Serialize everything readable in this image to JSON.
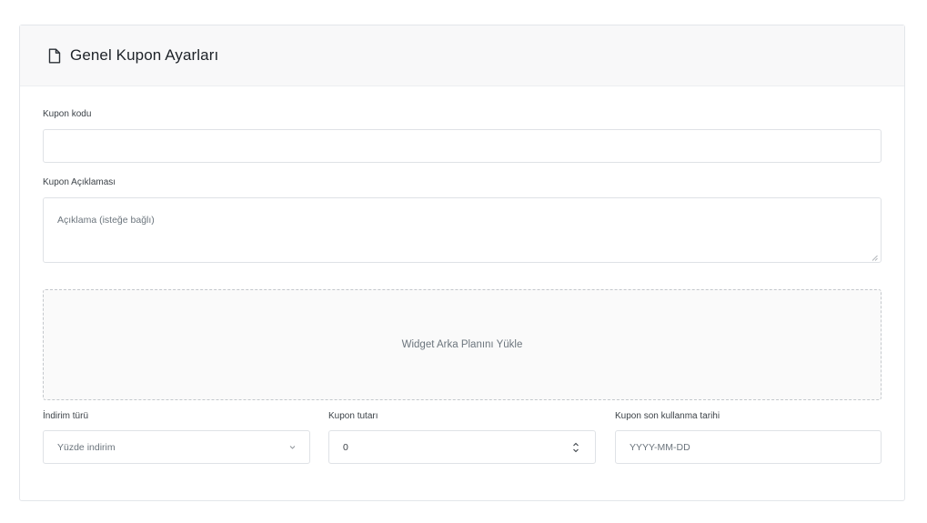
{
  "header": {
    "title": "Genel Kupon Ayarları",
    "icon": "document-icon"
  },
  "form": {
    "coupon_code": {
      "label": "Kupon kodu",
      "value": "",
      "placeholder": ""
    },
    "coupon_description": {
      "label": "Kupon Açıklaması",
      "value": "",
      "placeholder": "Açıklama (isteğe bağlı)"
    },
    "upload": {
      "label": "Widget Arka Planını Yükle"
    },
    "discount_type": {
      "label": "İndirim türü",
      "selected": "Yüzde indirim"
    },
    "coupon_amount": {
      "label": "Kupon tutarı",
      "value": "0"
    },
    "expiry_date": {
      "label": "Kupon son kullanma tarihi",
      "placeholder": "YYYY-MM-DD"
    }
  },
  "colors": {
    "header_bg": "#f8f8f9",
    "border": "#dfe2e6",
    "muted_text": "#6c757d"
  }
}
